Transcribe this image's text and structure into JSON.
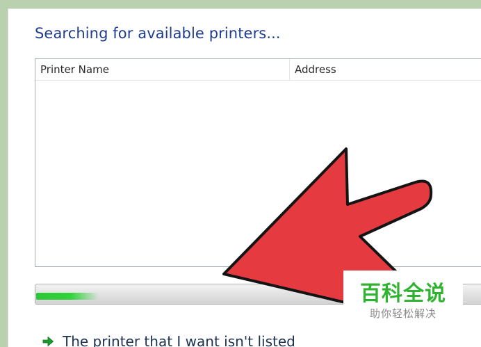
{
  "dialog": {
    "heading": "Searching for available printers...",
    "list": {
      "columns": [
        {
          "label": "Printer Name"
        },
        {
          "label": "Address"
        }
      ],
      "rows": []
    },
    "progress": {
      "state": "searching",
      "fill_fraction": 0.13,
      "color": "#1bc428"
    },
    "link": {
      "label": "The printer that I want isn't listed",
      "icon": "green-arrow-icon"
    }
  },
  "overlay": {
    "pointer": "red-arrow",
    "color": "#e43a40"
  },
  "watermark": {
    "title": "百科全说",
    "subtitle": "助你轻松解决"
  }
}
